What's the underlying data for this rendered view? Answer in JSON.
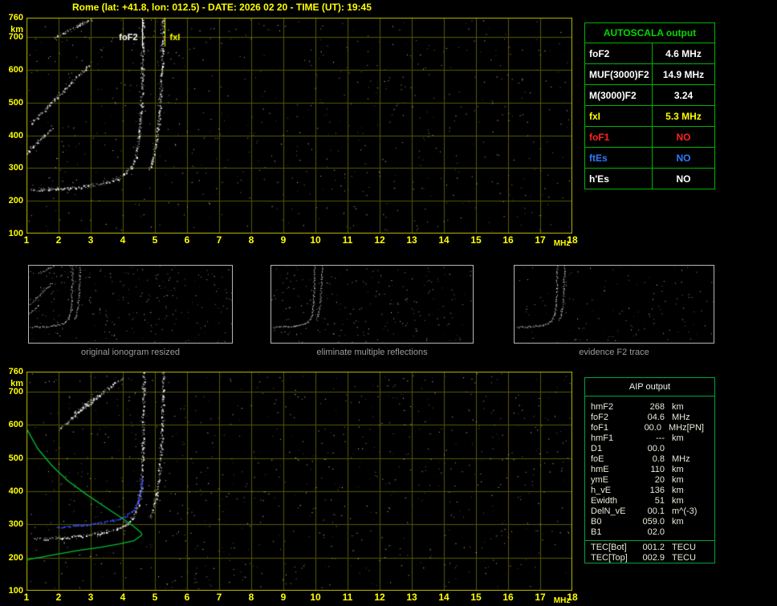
{
  "title": "Rome (lat: +41.8, lon: 012.5) - DATE: 2026 02 20 - TIME (UT): 19:45",
  "colors": {
    "background": "#000000",
    "title_text": "#ffff00",
    "axis_text": "#ffff00",
    "plot_border": "#b9b900",
    "grid": "#585800",
    "trace": "#ffffff",
    "profile_green": "#00c132",
    "scaled_trace_blue": "#3c50ff",
    "table_green": "#00b400",
    "caption_gray": "#9c9c9c"
  },
  "autoscala_table": {
    "title": "AUTOSCALA output",
    "rows": [
      {
        "label": "foF2",
        "value": "4.6 MHz",
        "color": "#ffffff"
      },
      {
        "label": "MUF(3000)F2",
        "value": "14.9 MHz",
        "color": "#ffffff"
      },
      {
        "label": "M(3000)F2",
        "value": "3.24",
        "color": "#ffffff"
      },
      {
        "label": "fxI",
        "value": "5.3 MHz",
        "color": "#ffff00"
      },
      {
        "label": "foF1",
        "value": "NO",
        "color": "#ff2222"
      },
      {
        "label": "ftEs",
        "value": "NO",
        "color": "#2e7bff"
      },
      {
        "label": "h'Es",
        "value": "NO",
        "color": "#ffffff"
      }
    ]
  },
  "thumbnails": [
    {
      "caption": "original ionogram resized"
    },
    {
      "caption": "eliminate multiple reflections"
    },
    {
      "caption": "evidence F2 trace"
    }
  ],
  "aip_table": {
    "title": "AIP output",
    "rows": [
      {
        "label": "hmF2",
        "value": "268",
        "unit": "km"
      },
      {
        "label": "foF2",
        "value": "04.6",
        "unit": "MHz"
      },
      {
        "label": "foF1",
        "value": "00.0",
        "unit": "MHz",
        "note": "[PN]"
      },
      {
        "label": "hmF1",
        "value": "---",
        "unit": "km"
      },
      {
        "label": "D1",
        "value": "00.0",
        "unit": ""
      },
      {
        "label": "foE",
        "value": "0.8",
        "unit": "MHz"
      },
      {
        "label": "hmE",
        "value": "110",
        "unit": "km"
      },
      {
        "label": "ymE",
        "value": "20",
        "unit": "km"
      },
      {
        "label": "h_vE",
        "value": "136",
        "unit": "km"
      },
      {
        "label": "Ewidth",
        "value": "51",
        "unit": "km"
      },
      {
        "label": "DelN_vE",
        "value": "00.1",
        "unit": "m^(-3)"
      },
      {
        "label": "B0",
        "value": "059.0",
        "unit": "km"
      },
      {
        "label": "B1",
        "value": "02.0",
        "unit": ""
      }
    ],
    "tec_rows": [
      {
        "label": "TEC[Bot]",
        "value": "001.2",
        "unit": "TECU"
      },
      {
        "label": "TEC[Top]",
        "value": "002.9",
        "unit": "TECU"
      }
    ]
  },
  "chart_data": [
    {
      "type": "scatter",
      "title": "",
      "xlabel": "MHz",
      "ylabel": "km",
      "xlim": [
        1,
        18
      ],
      "ylim": [
        100,
        760
      ],
      "xticks": [
        1,
        2,
        3,
        4,
        5,
        6,
        7,
        8,
        9,
        10,
        11,
        12,
        13,
        14,
        15,
        16,
        17,
        18
      ],
      "yticks": [
        760,
        700,
        600,
        500,
        400,
        300,
        200,
        100
      ],
      "grid": true,
      "noise_dots": 700,
      "annotations": [
        {
          "label": "foF2",
          "x": 4.6,
          "color": "#ffffff",
          "label_side": "left"
        },
        {
          "label": "fxI",
          "x": 5.3,
          "color": "#ffff00",
          "label_side": "right"
        }
      ],
      "series": [
        {
          "name": "F2 ordinary trace",
          "style": "speckle",
          "color": "#ffffff",
          "points": [
            [
              1.15,
              234
            ],
            [
              1.7,
              237
            ],
            [
              2.3,
              240
            ],
            [
              2.9,
              246
            ],
            [
              3.4,
              255
            ],
            [
              3.8,
              267
            ],
            [
              4.05,
              282
            ],
            [
              4.25,
              304
            ],
            [
              4.4,
              336
            ],
            [
              4.5,
              388
            ],
            [
              4.56,
              465
            ],
            [
              4.6,
              575
            ],
            [
              4.62,
              758
            ]
          ]
        },
        {
          "name": "F2 extraordinary trace",
          "style": "speckle",
          "color": "#ffffff",
          "points": [
            [
              4.8,
              298
            ],
            [
              4.95,
              338
            ],
            [
              5.05,
              392
            ],
            [
              5.13,
              465
            ],
            [
              5.19,
              565
            ],
            [
              5.23,
              675
            ],
            [
              5.25,
              758
            ]
          ]
        },
        {
          "name": "multiple reflection echo 1",
          "style": "speckle",
          "color": "#ffffff",
          "points": [
            [
              1.85,
              698
            ],
            [
              3.05,
              758
            ]
          ]
        },
        {
          "name": "multiple reflection echo 2",
          "style": "speckle",
          "color": "#ffffff",
          "points": [
            [
              1.15,
              438
            ],
            [
              2.9,
              612
            ]
          ]
        },
        {
          "name": "multiple reflection echo 3",
          "style": "speckle",
          "color": "#ffffff",
          "points": [
            [
              1.0,
              348
            ],
            [
              1.8,
              424
            ]
          ]
        }
      ]
    },
    {
      "type": "scatter",
      "title": "",
      "xlabel": "MHz",
      "ylabel": "km",
      "xlim": [
        1,
        18
      ],
      "ylim": [
        100,
        760
      ],
      "xticks": [
        1,
        2,
        3,
        4,
        5,
        6,
        7,
        8,
        9,
        10,
        11,
        12,
        13,
        14,
        15,
        16,
        17,
        18
      ],
      "yticks": [
        760,
        700,
        600,
        500,
        400,
        300,
        200,
        100
      ],
      "grid": true,
      "noise_dots": 850,
      "annotations": [],
      "series": [
        {
          "name": "F2 ordinary trace",
          "style": "speckle",
          "color": "#ffffff",
          "points": [
            [
              1.2,
              256
            ],
            [
              2.0,
              260
            ],
            [
              2.7,
              266
            ],
            [
              3.3,
              274
            ],
            [
              3.8,
              286
            ],
            [
              4.1,
              300
            ],
            [
              4.3,
              320
            ],
            [
              4.45,
              350
            ],
            [
              4.55,
              402
            ],
            [
              4.6,
              478
            ],
            [
              4.63,
              590
            ],
            [
              4.65,
              758
            ]
          ]
        },
        {
          "name": "F2 extraordinary trace",
          "style": "speckle",
          "color": "#ffffff",
          "points": [
            [
              4.85,
              318
            ],
            [
              5.0,
              368
            ],
            [
              5.1,
              428
            ],
            [
              5.18,
              518
            ],
            [
              5.23,
              638
            ],
            [
              5.26,
              758
            ]
          ]
        },
        {
          "name": "multiple reflection echo 1",
          "style": "speckle",
          "color": "#ffffff",
          "points": [
            [
              2.0,
              588
            ],
            [
              3.3,
              692
            ]
          ]
        },
        {
          "name": "multiple reflection echo 2",
          "style": "speckle",
          "color": "#ffffff",
          "points": [
            [
              2.5,
              638
            ],
            [
              4.0,
              742
            ]
          ]
        },
        {
          "name": "scaled F2 trace",
          "style": "dots",
          "color": "#3c50ff",
          "points": [
            [
              1.95,
              292
            ],
            [
              2.6,
              298
            ],
            [
              3.2,
              305
            ],
            [
              3.7,
              313
            ],
            [
              4.05,
              324
            ],
            [
              4.3,
              341
            ],
            [
              4.45,
              366
            ],
            [
              4.55,
              406
            ],
            [
              4.6,
              442
            ]
          ]
        },
        {
          "name": "electron density profile topside",
          "style": "line",
          "color": "#00c132",
          "points": [
            [
              1.02,
              585
            ],
            [
              1.35,
              528
            ],
            [
              1.8,
              476
            ],
            [
              2.3,
              430
            ],
            [
              2.9,
              388
            ],
            [
              3.5,
              349
            ],
            [
              4.0,
              317
            ],
            [
              4.35,
              293
            ],
            [
              4.55,
              277
            ],
            [
              4.6,
              268
            ]
          ]
        },
        {
          "name": "electron density profile bottomside",
          "style": "line",
          "color": "#00c132",
          "points": [
            [
              4.6,
              268
            ],
            [
              4.35,
              251
            ],
            [
              3.9,
              241
            ],
            [
              3.3,
              231
            ],
            [
              2.6,
              221
            ],
            [
              2.0,
              211
            ],
            [
              1.5,
              202
            ],
            [
              1.15,
              196
            ],
            [
              1.0,
              192
            ]
          ]
        }
      ]
    }
  ]
}
